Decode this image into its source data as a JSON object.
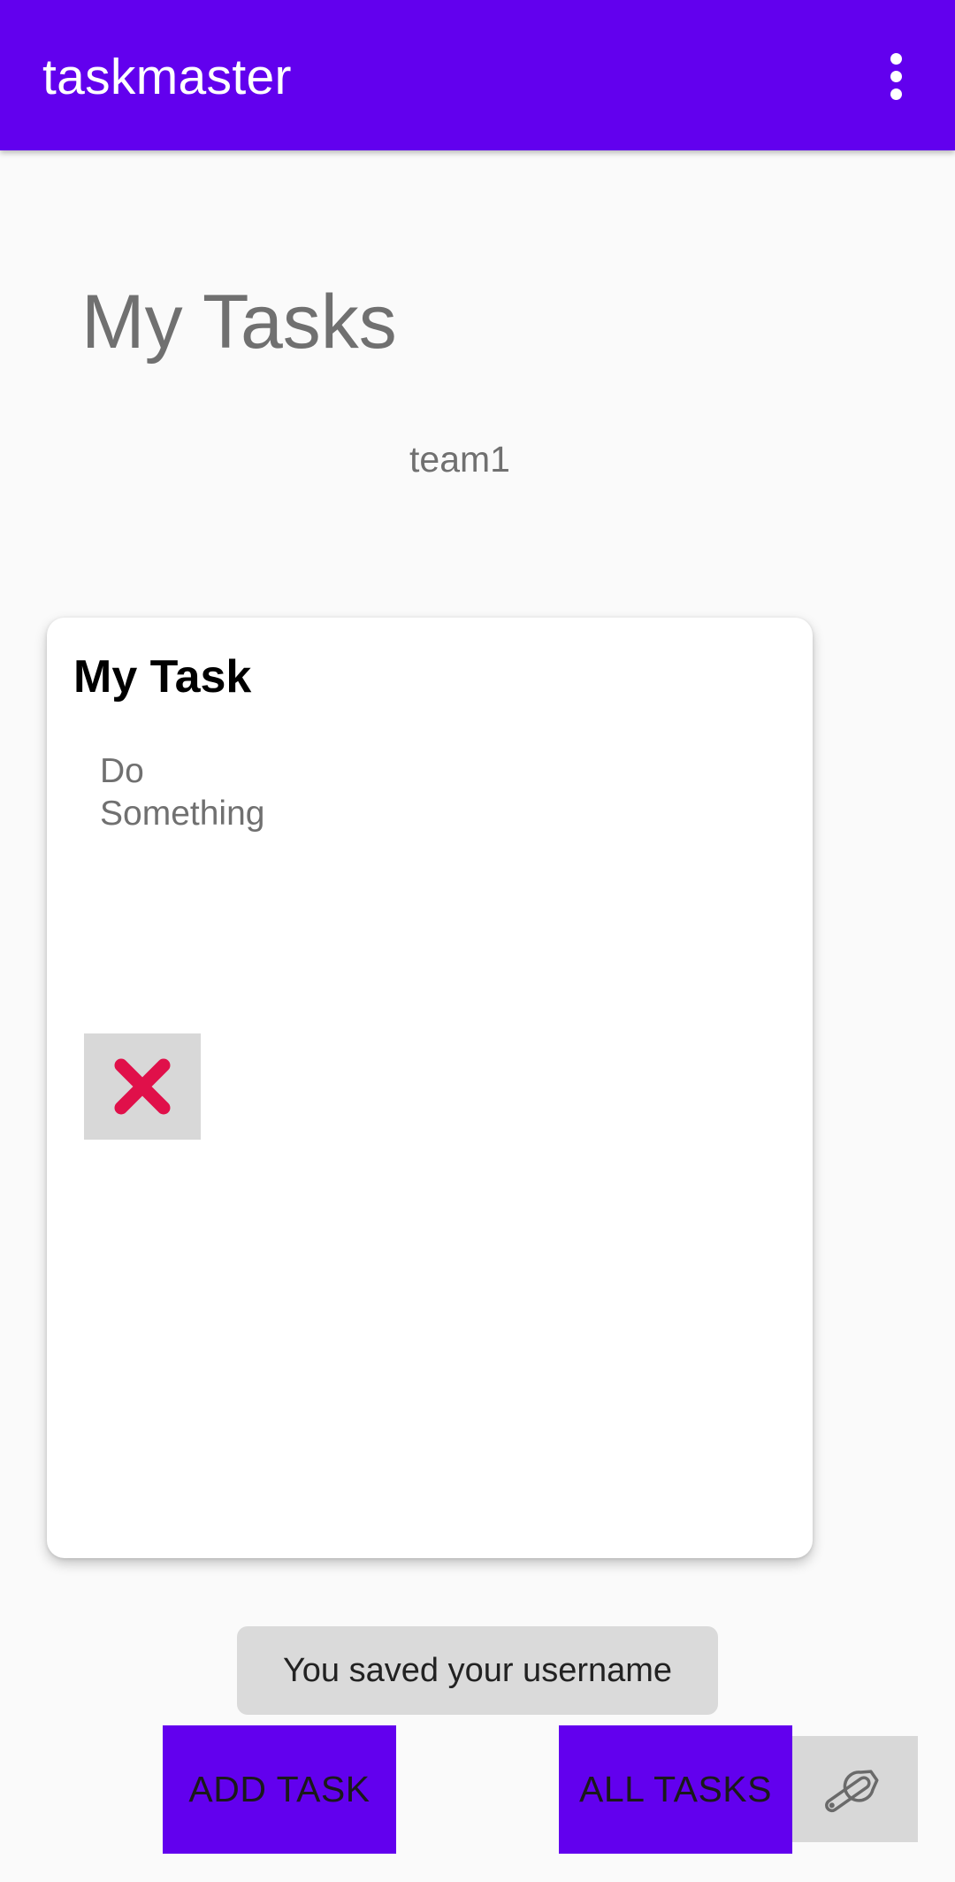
{
  "app_bar": {
    "title": "taskmaster",
    "overflow_icon": "more-vert-icon",
    "background_color": "#6200ee"
  },
  "main": {
    "heading": "My Tasks",
    "team": "team1"
  },
  "task_card": {
    "title": "My Task",
    "body": "Do\nSomething",
    "delete_icon": "close-x-icon",
    "delete_icon_color": "#e0104a"
  },
  "toast": {
    "message": "You saved your username"
  },
  "buttons": {
    "add_task": "ADD TASK",
    "all_tasks": "ALL TASKS",
    "settings_icon": "wrench-icon",
    "accent_color": "#6200ee"
  }
}
